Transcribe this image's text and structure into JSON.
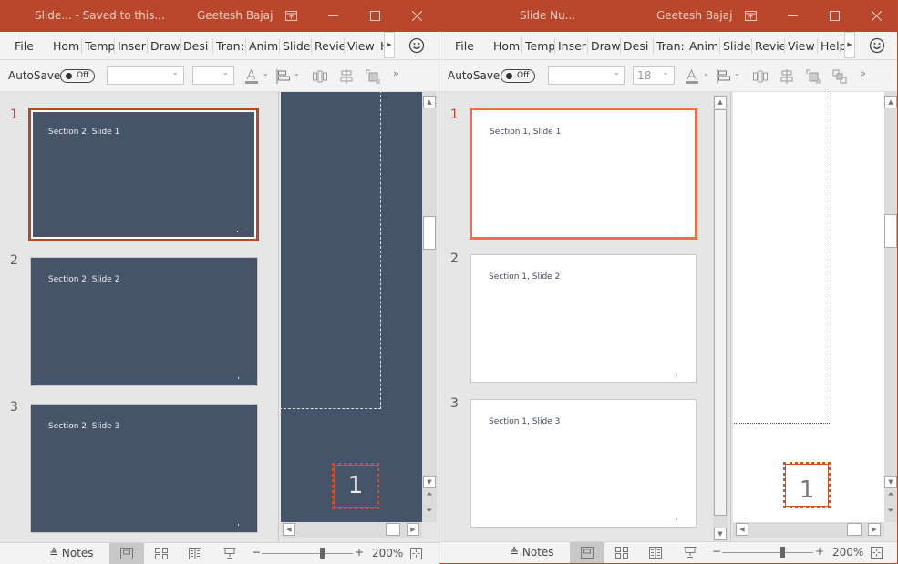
{
  "windows": {
    "left": {
      "title": "Slide...  - Saved to this...",
      "user": "Geetesh Bajaj",
      "tabs": [
        "File",
        "Hom",
        "Temp",
        "Inser",
        "Draw",
        "Desi",
        "Tran:",
        "Anim",
        "Slide",
        "Revie",
        "View",
        "H"
      ],
      "autosave_label": "AutoSave",
      "autosave_state": "Off",
      "font_name": "",
      "font_size": "",
      "slides": [
        {
          "number": "1",
          "title": "Section 2, Slide 1",
          "selected": true
        },
        {
          "number": "2",
          "title": "Section 2, Slide 2",
          "selected": false
        },
        {
          "number": "3",
          "title": "Section 2, Slide 3",
          "selected": false
        }
      ],
      "theme": "dark",
      "slide_number_placeholder": "1",
      "notes_label": "Notes",
      "zoom_level": "200%"
    },
    "right": {
      "title": "Slide Nu...",
      "user": "Geetesh Bajaj",
      "tabs": [
        "File",
        "Hom",
        "Temp",
        "Inser",
        "Draw",
        "Desi",
        "Tran:",
        "Anim",
        "Slide",
        "Revie",
        "View",
        "Help"
      ],
      "autosave_label": "AutoSave",
      "autosave_state": "Off",
      "font_name": "",
      "font_size": "18",
      "slides": [
        {
          "number": "1",
          "title": "Section 1, Slide 1",
          "selected": true
        },
        {
          "number": "2",
          "title": "Section 1, Slide 2",
          "selected": false
        },
        {
          "number": "3",
          "title": "Section 1, Slide 3",
          "selected": false
        }
      ],
      "theme": "light",
      "slide_number_placeholder": "1",
      "notes_label": "Notes",
      "zoom_level": "200%"
    }
  },
  "icons": {
    "title_buttons": [
      "ribbon-display-icon",
      "minimize-icon",
      "maximize-icon",
      "close-icon"
    ],
    "toolbar": [
      "font-color-icon",
      "align-icon",
      "distribute-icon",
      "align-center-icon",
      "arrange-icon",
      "group-icon",
      "more-icon"
    ],
    "status": [
      "notes-icon",
      "normal-view-icon",
      "slide-sorter-icon",
      "reading-view-icon",
      "slideshow-icon",
      "fit-slide-icon"
    ]
  },
  "colors": {
    "accent": "#b9472b",
    "dark_slide": "#455468",
    "selection_light": "#e9704f"
  }
}
